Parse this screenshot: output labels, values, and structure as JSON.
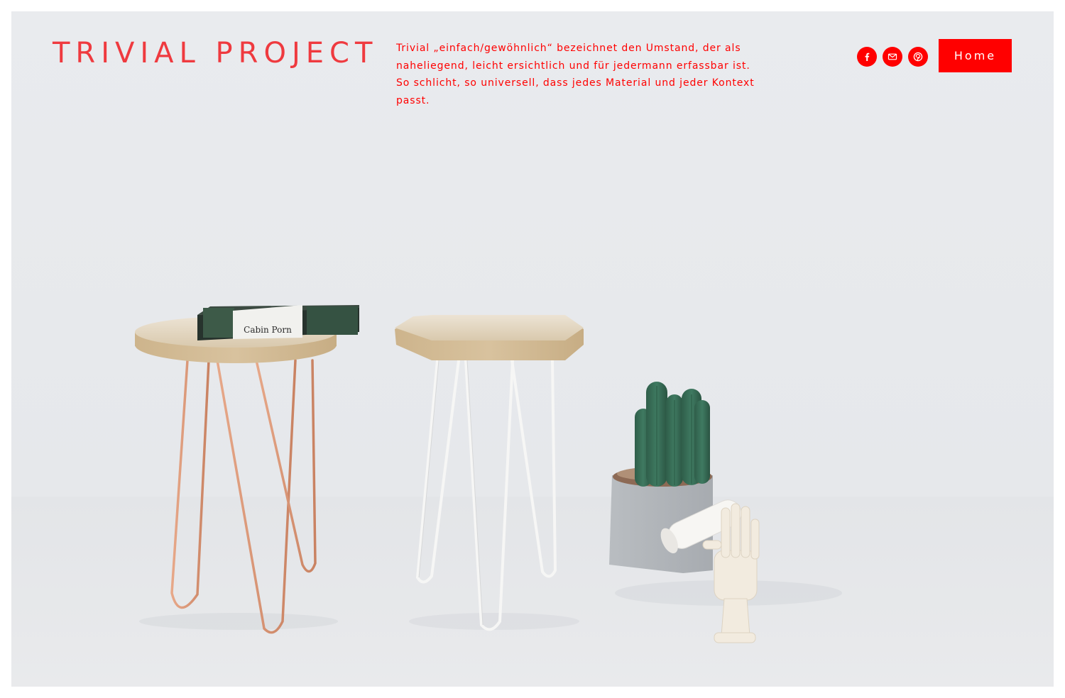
{
  "header": {
    "site_title": "TRIVIAL PROJECT",
    "tagline": "Trivial „einfach/gewöhnlich“ bezeichnet den Umstand, der als naheliegend, leicht ersichtlich und für jedermann erfassbar ist. So schlicht, so universell, dass jedes Material und jeder Kontext passt.",
    "social_icons": [
      "facebook-icon",
      "mail-icon",
      "pinterest-icon"
    ],
    "nav_button_label": "Home"
  },
  "hero": {
    "book_title": "Cabin Porn"
  },
  "colors": {
    "accent": "#ff0000",
    "title": "#ef3a3f",
    "background": "#e9ebee"
  }
}
